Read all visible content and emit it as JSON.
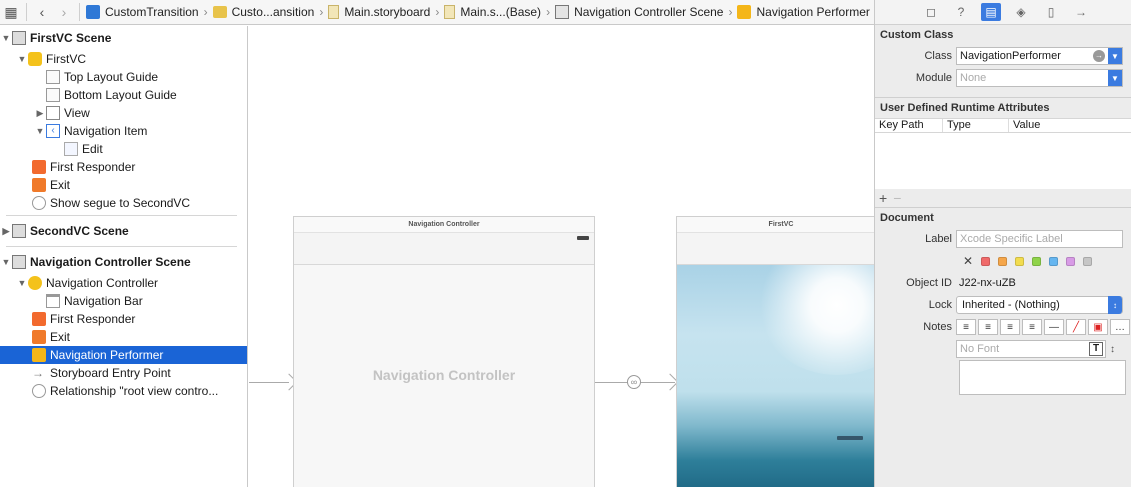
{
  "jumpbar": {
    "crumbs": [
      {
        "label": "CustomTransition",
        "icon": "project-icon"
      },
      {
        "label": "Custo...ansition",
        "icon": "folder-icon"
      },
      {
        "label": "Main.storyboard",
        "icon": "storyboard-file-icon"
      },
      {
        "label": "Main.s...(Base)",
        "icon": "storyboard-file-icon"
      },
      {
        "label": "Navigation Controller Scene",
        "icon": "scene-icon"
      },
      {
        "label": "Navigation Performer",
        "icon": "object-icon"
      }
    ]
  },
  "outline": {
    "scene1": {
      "title": "FirstVC Scene",
      "controller": "FirstVC",
      "items": [
        "Top Layout Guide",
        "Bottom Layout Guide",
        "View",
        "Navigation Item",
        "Edit",
        "First Responder",
        "Exit",
        "Show segue to SecondVC"
      ]
    },
    "scene2": {
      "title": "SecondVC Scene"
    },
    "scene3": {
      "title": "Navigation Controller Scene",
      "items": [
        "Navigation Controller",
        "Navigation Bar",
        "First Responder",
        "Exit",
        "Navigation Performer",
        "Storyboard Entry Point",
        "Relationship \"root view contro..."
      ]
    }
  },
  "canvas": {
    "nav_scene_title": "Navigation Controller",
    "nav_placeholder": "Navigation Controller",
    "first_scene_title": "FirstVC"
  },
  "inspector": {
    "custom_class": {
      "header": "Custom Class",
      "class_label": "Class",
      "class_value": "NavigationPerformer",
      "module_label": "Module",
      "module_placeholder": "None"
    },
    "runtime_attrs": {
      "header": "User Defined Runtime Attributes",
      "col_key": "Key Path",
      "col_type": "Type",
      "col_value": "Value",
      "add": "+",
      "remove": "−"
    },
    "document": {
      "header": "Document",
      "label_label": "Label",
      "label_placeholder": "Xcode Specific Label",
      "swatches": [
        "#f06a6a",
        "#f5a64a",
        "#f2dc4f",
        "#8fd34a",
        "#66b6f0",
        "#d89be6",
        "#c6c6c6"
      ],
      "object_id_label": "Object ID",
      "object_id": "J22-nx-uZB",
      "lock_label": "Lock",
      "lock_value": "Inherited - (Nothing)",
      "notes_label": "Notes",
      "font_placeholder": "No Font"
    }
  },
  "colors": {
    "selection": "#1a64d6",
    "accent": "#3b7be0"
  }
}
